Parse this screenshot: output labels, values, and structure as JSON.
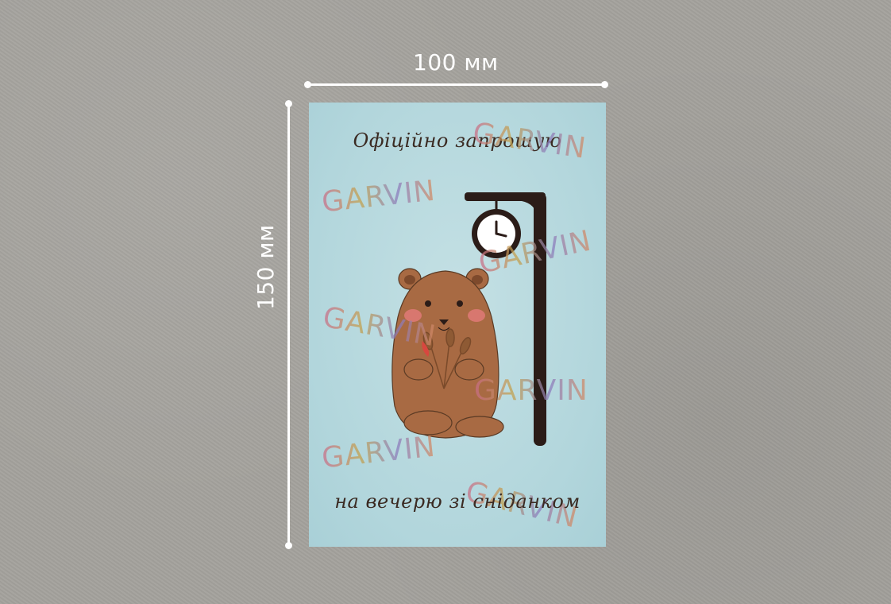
{
  "dimensions": {
    "width_label": "100 мм",
    "height_label": "150 мм"
  },
  "card": {
    "title": "Офіційно запрошую",
    "subtitle": "на вечерю зі сніданком",
    "watermark": "GARVIN",
    "background_color": "#b8d9de",
    "illustration": {
      "character": "groundhog-with-wheat",
      "object": "street-clock-lamp"
    }
  }
}
